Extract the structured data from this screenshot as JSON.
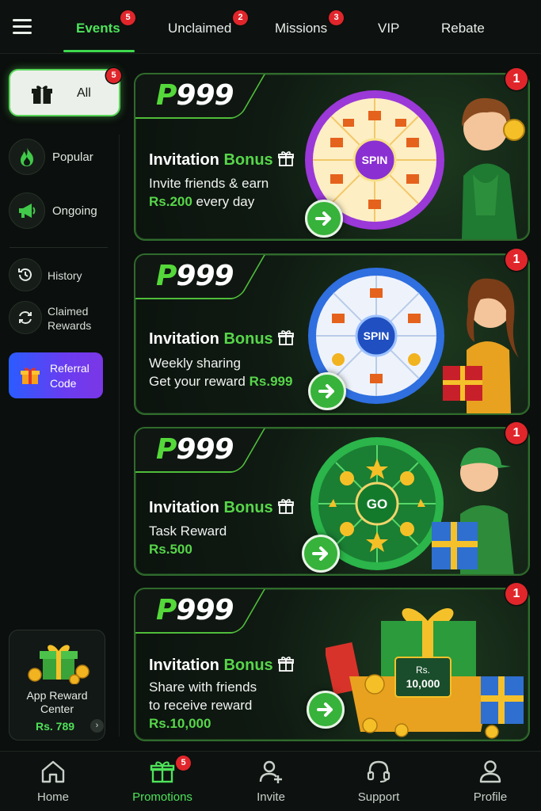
{
  "top_tabs": [
    {
      "label": "Events",
      "badge": "5"
    },
    {
      "label": "Unclaimed",
      "badge": "2"
    },
    {
      "label": "Missions",
      "badge": "3"
    },
    {
      "label": "VIP"
    },
    {
      "label": "Rebate"
    }
  ],
  "sidebar": {
    "all": {
      "label": "All",
      "badge": "5"
    },
    "popular": {
      "label": "Popular"
    },
    "ongoing": {
      "label": "Ongoing"
    },
    "history": {
      "label": "History"
    },
    "claimed_rewards": {
      "line1": "Claimed",
      "line2": "Rewards"
    },
    "referral_code": {
      "line1": "Referral",
      "line2": "Code"
    },
    "reward_center": {
      "line1": "App Reward",
      "line2": "Center",
      "amount": "Rs. 789"
    }
  },
  "cards": [
    {
      "logo_p": "P",
      "logo_num": "999",
      "title_main": "Invitation ",
      "title_hl": "Bonus",
      "line1": "Invite friends & earn",
      "line2_hl": "Rs.200",
      "line2_rest": " every day",
      "badge": "1",
      "wheel_label": "SPIN"
    },
    {
      "logo_p": "P",
      "logo_num": "999",
      "title_main": "Invitation ",
      "title_hl": "Bonus",
      "line1": "Weekly sharing",
      "line2_pre": "Get your reward ",
      "line2_hl": "Rs.999",
      "badge": "1",
      "wheel_label": "SPIN"
    },
    {
      "logo_p": "P",
      "logo_num": "999",
      "title_main": "Invitation ",
      "title_hl": "Bonus",
      "line1": "Task Reward",
      "line2_hl": "Rs.500",
      "badge": "1",
      "wheel_label": "GO"
    },
    {
      "logo_p": "P",
      "logo_num": "999",
      "title_main": "Invitation ",
      "title_hl": "Bonus",
      "line1": "Share with friends",
      "line2": "to receive reward",
      "line3_hl": "Rs.10,000",
      "badge": "1",
      "note_top": "Rs.",
      "note_amount": "10,000"
    }
  ],
  "bottom_nav": [
    {
      "label": "Home"
    },
    {
      "label": "Promotions",
      "badge": "5"
    },
    {
      "label": "Invite"
    },
    {
      "label": "Support"
    },
    {
      "label": "Profile"
    }
  ],
  "colors": {
    "accent": "#4ee35a",
    "badge": "#e0262b",
    "referral_start": "#2a5cff",
    "referral_end": "#7b37e6"
  }
}
